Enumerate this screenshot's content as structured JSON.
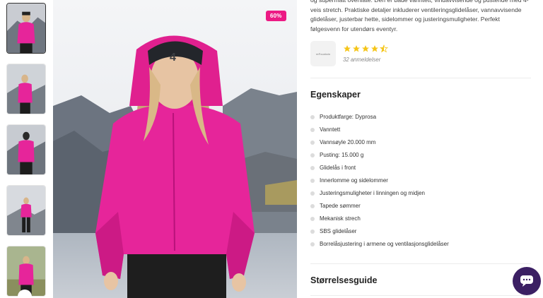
{
  "product": {
    "badge": "60%",
    "description": "og supermatt overflate. Den er både vanntett, vindavvisende og pustende med 4-veis stretch. Praktiske detaljer inkluderer ventileringsglidelåser, vannavvisende glidelåser, justerbar hette, sidelommer og justeringsmuligheter. Perfekt følgesvenn for utendørs eventyr."
  },
  "review": {
    "logo_text": "reFountain",
    "rating": 4.5,
    "count_label": "32 anmeldelser",
    "star_color": "#f5c518"
  },
  "features": {
    "heading": "Egenskaper",
    "items": [
      "Produktfarge: Dyprosa",
      "Vanntett",
      "Vannsøyle 20.000 mm",
      "Pusting: 15.000 g",
      "Glidelås i front",
      "Innerlomme og sidelommer",
      "Justeringsmuligheter i linningen og midjen",
      "Tapede sømmer",
      "Mekanisk strech",
      "SBS glidelåser",
      "Borrelåsjustering i armene og ventilasjonsglidelåser"
    ]
  },
  "size_guide": {
    "heading": "Størrelsesguide"
  },
  "colors": {
    "accent": "#ec1a84",
    "chat": "#3b1f63"
  },
  "icons": {
    "chat": "chat-bubble-icon",
    "star": "star-icon"
  }
}
